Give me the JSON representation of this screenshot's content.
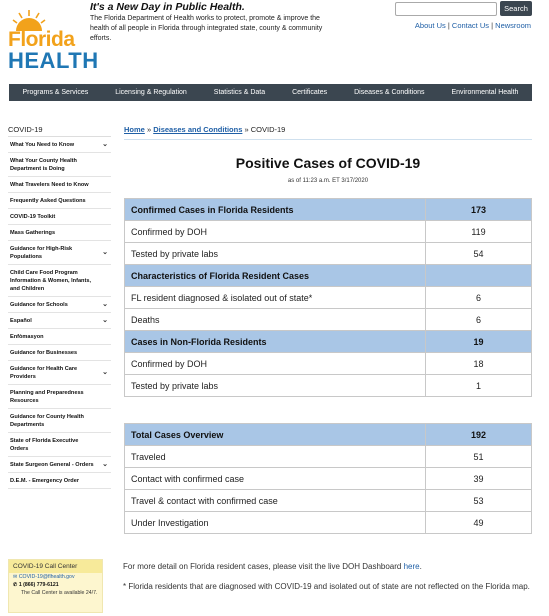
{
  "header": {
    "logo_text_1": "Florida",
    "logo_text_2": "HEALTH",
    "tagline": "It's a New Day in Public Health.",
    "mission": "The Florida Department of Health works to protect, promote & improve the health of all people in Florida through integrated state, county & community efforts.",
    "search_placeholder": "",
    "search_label": "Search",
    "links": [
      "About Us",
      "Contact Us",
      "Newsroom"
    ],
    "link_sep": "|"
  },
  "nav": [
    "Programs & Services",
    "Licensing & Regulation",
    "Statistics & Data",
    "Certificates",
    "Diseases & Conditions",
    "Environmental Health"
  ],
  "sidebar": {
    "title": "COVID-19",
    "items": [
      {
        "label": "What You Need to Know",
        "chevron": true
      },
      {
        "label": "What Your County Health Department is Doing",
        "chevron": false
      },
      {
        "label": "What Travelers Need to Know",
        "chevron": false
      },
      {
        "label": "Frequently Asked Questions",
        "chevron": false
      },
      {
        "label": "COVID-19 Toolkit",
        "chevron": false
      },
      {
        "label": "Mass Gatherings",
        "chevron": false
      },
      {
        "label": "Guidance for High-Risk Populations",
        "chevron": true
      },
      {
        "label": "Child Care Food Program Information & Women, Infants, and Children",
        "chevron": false
      },
      {
        "label": "Guidance for Schools",
        "chevron": true
      },
      {
        "label": "Español",
        "chevron": true
      },
      {
        "label": "Enfòmasyon",
        "chevron": false
      },
      {
        "label": "Guidance for Businesses",
        "chevron": false
      },
      {
        "label": "Guidance for Health Care Providers",
        "chevron": true
      },
      {
        "label": "Planning and Preparedness Resources",
        "chevron": false
      },
      {
        "label": "Guidance for County Health Departments",
        "chevron": false
      },
      {
        "label": "State of Florida Executive Orders",
        "chevron": false
      },
      {
        "label": "State Surgeon General - Orders",
        "chevron": true
      },
      {
        "label": "D.E.M. - Emergency Order",
        "chevron": false
      }
    ],
    "chevron_glyph": "⌄",
    "call_center": {
      "title": "COVID-19 Call Center",
      "email": "COVID-19@flhealth.gov",
      "phone": "1 (866) 779-6121",
      "note": "The Call Center is available 24/7."
    }
  },
  "breadcrumb": {
    "home": "Home",
    "sep": "»",
    "diseases": "Diseases and Conditions",
    "current": "COVID-19"
  },
  "main": {
    "title": "Positive Cases of COVID-19",
    "as_of": "as of 11:23 a.m. ET 3/17/2020",
    "table1": [
      {
        "label": "Confirmed Cases in Florida Residents",
        "value": "173",
        "head": true
      },
      {
        "label": "Confirmed by DOH",
        "value": "119",
        "head": false
      },
      {
        "label": "Tested by private labs",
        "value": "54",
        "head": false
      },
      {
        "label": "Characteristics of Florida Resident Cases",
        "value": "",
        "head": true
      },
      {
        "label": "FL resident diagnosed & isolated out of state*",
        "value": "6",
        "head": false
      },
      {
        "label": "Deaths",
        "value": "6",
        "head": false
      },
      {
        "label": "Cases in Non-Florida Residents",
        "value": "19",
        "head": true
      },
      {
        "label": "Confirmed by DOH",
        "value": "18",
        "head": false
      },
      {
        "label": "Tested by private labs",
        "value": "1",
        "head": false
      }
    ],
    "table2": [
      {
        "label": "Total Cases Overview",
        "value": "192",
        "head": true
      },
      {
        "label": "Traveled",
        "value": "51",
        "head": false
      },
      {
        "label": "Contact with confirmed case",
        "value": "39",
        "head": false
      },
      {
        "label": "Travel & contact with confirmed case",
        "value": "53",
        "head": false
      },
      {
        "label": "Under Investigation",
        "value": "49",
        "head": false
      }
    ],
    "note1_prefix": "For more detail on Florida resident cases, please visit the live DOH Dashboard",
    "note1_link": "here",
    "note1_suffix": ".",
    "note2": "* Florida residents that are diagnosed with COVID-19 and isolated out of state are not reflected on the Florida map."
  },
  "colors": {
    "nav_bg": "#3b4650",
    "table_head": "#a9c6e6",
    "link": "#1f5fa6",
    "logo_orange": "#f2a21b",
    "logo_blue": "#1f77b4"
  }
}
